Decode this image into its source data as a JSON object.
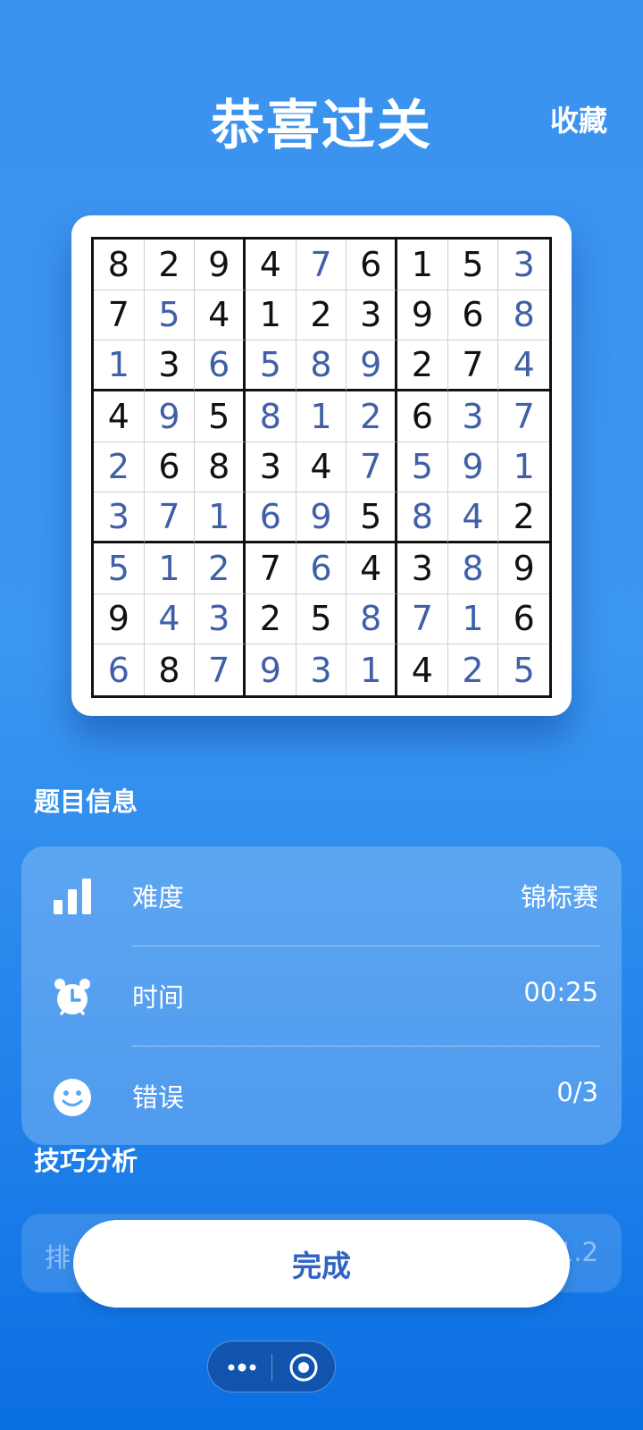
{
  "header": {
    "title": "恭喜过关",
    "favorite_label": "收藏"
  },
  "board": {
    "rows": [
      [
        "8",
        "2",
        "9",
        "4",
        "7",
        "6",
        "1",
        "5",
        "3"
      ],
      [
        "7",
        "5",
        "4",
        "1",
        "2",
        "3",
        "9",
        "6",
        "8"
      ],
      [
        "1",
        "3",
        "6",
        "5",
        "8",
        "9",
        "2",
        "7",
        "4"
      ],
      [
        "4",
        "9",
        "5",
        "8",
        "1",
        "2",
        "6",
        "3",
        "7"
      ],
      [
        "2",
        "6",
        "8",
        "3",
        "4",
        "7",
        "5",
        "9",
        "1"
      ],
      [
        "3",
        "7",
        "1",
        "6",
        "9",
        "5",
        "8",
        "4",
        "2"
      ],
      [
        "5",
        "1",
        "2",
        "7",
        "6",
        "4",
        "3",
        "8",
        "9"
      ],
      [
        "9",
        "4",
        "3",
        "2",
        "5",
        "8",
        "7",
        "1",
        "6"
      ],
      [
        "6",
        "8",
        "7",
        "9",
        "3",
        "1",
        "4",
        "2",
        "5"
      ]
    ],
    "given_mask": [
      [
        1,
        1,
        1,
        1,
        0,
        1,
        1,
        1,
        0
      ],
      [
        1,
        0,
        1,
        1,
        1,
        1,
        1,
        1,
        0
      ],
      [
        0,
        1,
        0,
        0,
        0,
        0,
        1,
        1,
        0
      ],
      [
        1,
        0,
        1,
        0,
        0,
        0,
        1,
        0,
        0
      ],
      [
        0,
        1,
        1,
        1,
        1,
        0,
        0,
        0,
        0
      ],
      [
        0,
        0,
        0,
        0,
        0,
        1,
        0,
        0,
        1
      ],
      [
        0,
        0,
        0,
        1,
        0,
        1,
        1,
        0,
        1
      ],
      [
        1,
        0,
        0,
        1,
        1,
        0,
        0,
        0,
        1
      ],
      [
        0,
        1,
        0,
        0,
        0,
        0,
        1,
        0,
        0
      ]
    ],
    "given_color": "#111111",
    "filled_color": "#3f5fa8"
  },
  "info": {
    "section_title": "题目信息",
    "difficulty": {
      "label": "难度",
      "value": "锦标赛",
      "icon": "bar-chart-icon"
    },
    "time": {
      "label": "时间",
      "value": "00:25",
      "icon": "alarm-clock-icon"
    },
    "errors": {
      "label": "错误",
      "value": "0/3",
      "icon": "smiley-icon"
    }
  },
  "analysis": {
    "section_title": "技巧分析",
    "label_partial": "排",
    "value_partial": "1.2"
  },
  "done_button": {
    "label": "完成"
  },
  "capsule": {
    "more_icon": "more-dots-icon",
    "close_icon": "target-circle-icon"
  }
}
